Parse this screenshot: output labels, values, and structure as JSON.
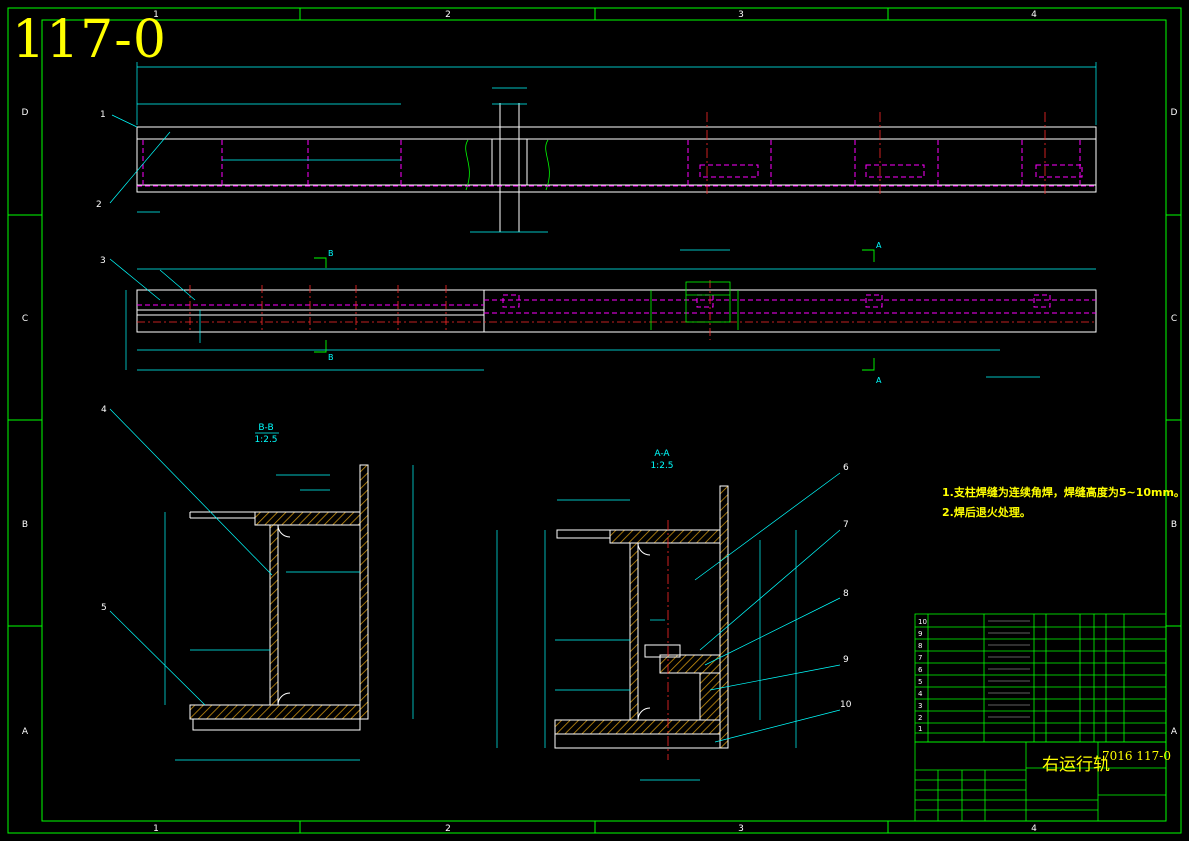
{
  "drawing_number": "117-0",
  "border": {
    "top_zones": [
      "1",
      "2",
      "3",
      "4"
    ],
    "bottom_zones": [
      "1",
      "2",
      "3",
      "4"
    ],
    "left_zones": [
      "D",
      "C",
      "B",
      "A"
    ],
    "right_zones": [
      "D",
      "C",
      "B",
      "A"
    ]
  },
  "views": {
    "section_b": {
      "title": "B-B",
      "scale": "1:2.5"
    },
    "section_a": {
      "title": "A-A",
      "scale": "1:2.5"
    },
    "cut_labels": [
      "A",
      "A",
      "B",
      "B"
    ]
  },
  "leader_numbers": [
    "1",
    "2",
    "3",
    "4",
    "5",
    "6",
    "7",
    "8",
    "9",
    "10"
  ],
  "notes": [
    "1.支柱焊缝为连续角焊，焊缝高度为5~10mm。",
    "2.焊后退火处理。"
  ],
  "parts_list": {
    "item_numbers": [
      "10",
      "9",
      "8",
      "7",
      "6",
      "5",
      "4",
      "3",
      "2",
      "1"
    ]
  },
  "title_block": {
    "name": "右运行轨",
    "code": "7016 117-0"
  },
  "colors": {
    "background": "#000000",
    "frame": "#00ff00",
    "outline": "#ffffff",
    "dimension": "#00ffff",
    "hidden": "#ff00ff",
    "centerline": "#ff2a2a",
    "text": "#ffff00",
    "hatch": "#b8860b"
  }
}
